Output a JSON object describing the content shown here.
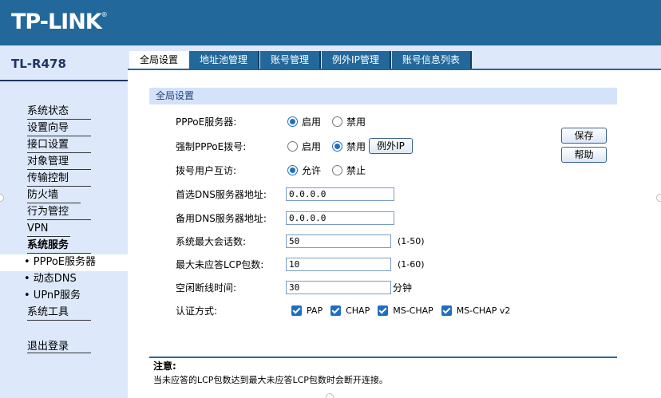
{
  "header": {
    "logo": "TP-LINK",
    "logo_mark": "®"
  },
  "sidebar": {
    "model": "TL-R478",
    "items": [
      {
        "label": "系统状态",
        "type": "link"
      },
      {
        "label": "设置向导",
        "type": "link"
      },
      {
        "label": "接口设置",
        "type": "link"
      },
      {
        "label": "对象管理",
        "type": "link"
      },
      {
        "label": "传输控制",
        "type": "link"
      },
      {
        "label": "防火墙",
        "type": "link"
      },
      {
        "label": "行为管控",
        "type": "link"
      },
      {
        "label": "VPN",
        "type": "link"
      },
      {
        "label": "系统服务",
        "type": "group"
      },
      {
        "label": "• PPPoE服务器",
        "type": "sub-active"
      },
      {
        "label": "• 动态DNS",
        "type": "sub"
      },
      {
        "label": "• UPnP服务",
        "type": "sub"
      },
      {
        "label": "系统工具",
        "type": "link"
      }
    ],
    "logout": "退出登录"
  },
  "tabs": [
    "全局设置",
    "地址池管理",
    "账号管理",
    "例外IP管理",
    "账号信息列表"
  ],
  "active_tab": 0,
  "section_title": "全局设置",
  "form": {
    "pppoe_server": {
      "label": "PPPoE服务器:",
      "options": [
        "启用",
        "禁用"
      ],
      "selected": "启用"
    },
    "force_pppoe": {
      "label": "强制PPPoE拨号:",
      "options": [
        "启用",
        "禁用"
      ],
      "selected": "禁用",
      "button": "例外IP"
    },
    "user_interop": {
      "label": "拨号用户互访:",
      "options": [
        "允许",
        "禁止"
      ],
      "selected": "允许"
    },
    "primary_dns": {
      "label": "首选DNS服务器地址:",
      "value": "0.0.0.0"
    },
    "secondary_dns": {
      "label": "备用DNS服务器地址:",
      "value": "0.0.0.0"
    },
    "max_sessions": {
      "label": "系统最大会话数:",
      "value": "50",
      "hint": "(1-50)"
    },
    "max_lcp": {
      "label": "最大未应答LCP包数:",
      "value": "10",
      "hint": "(1-60)"
    },
    "idle_time": {
      "label": "空闲断线时间:",
      "value": "30",
      "hint": "分钟"
    },
    "auth": {
      "label": "认证方式:",
      "options": [
        "PAP",
        "CHAP",
        "MS-CHAP",
        "MS-CHAP v2"
      ],
      "checked": [
        true,
        true,
        true,
        true
      ]
    }
  },
  "buttons": {
    "save": "保存",
    "help": "帮助"
  },
  "note": {
    "title": "注意:",
    "body": "当未应答的LCP包数达到最大未应答LCP包数时会断开连接。"
  },
  "colors": {
    "header": "#23689b",
    "sidebar_bg": "#dde9fb",
    "section_head": "#d4e3fa",
    "accent": "#1f6fc0"
  }
}
